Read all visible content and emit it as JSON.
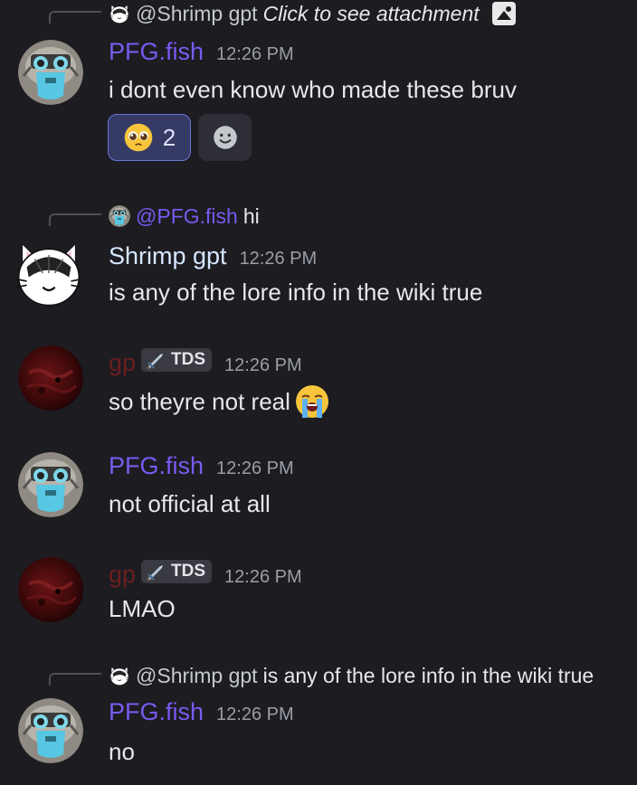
{
  "messages": [
    {
      "reply": {
        "username": "@Shrimp gpt",
        "text": "Click to see attachment",
        "italic": true,
        "avatar_icon": "cat-avatar-icon",
        "attachment_icon": "image-icon"
      },
      "username": "PFG.fish",
      "timestamp": "12:26 PM",
      "avatar_icon": "fish-mask-avatar",
      "text": "i dont even know who made these bruv",
      "reactions": [
        {
          "emoji": "pleading-face-emoji",
          "count": "2"
        }
      ],
      "add_reaction_icon": "smile-add-reaction-icon"
    },
    {
      "reply": {
        "username": "@PFG.fish",
        "text": "hi",
        "avatar_icon": "fish-mask-avatar-small"
      },
      "username": "Shrimp gpt",
      "timestamp": "12:26 PM",
      "avatar_icon": "cat-avatar",
      "text": "is any of the lore info in the wiki true"
    },
    {
      "username": "gp",
      "tag": "TDS",
      "tag_icon": "sword-icon",
      "timestamp": "12:26 PM",
      "avatar_icon": "red-planet-avatar",
      "text": "so theyre not real",
      "trailing_emoji": "loudly-crying-face-emoji"
    },
    {
      "username": "PFG.fish",
      "timestamp": "12:26 PM",
      "avatar_icon": "fish-mask-avatar",
      "text": "not official at all"
    },
    {
      "username": "gp",
      "tag": "TDS",
      "tag_icon": "sword-icon",
      "timestamp": "12:26 PM",
      "avatar_icon": "red-planet-avatar",
      "text": "LMAO"
    },
    {
      "reply": {
        "username": "@Shrimp gpt",
        "text": "is any of the lore info in the wiki true",
        "avatar_icon": "cat-avatar-icon"
      },
      "username": "PFG.fish",
      "timestamp": "12:26 PM",
      "avatar_icon": "fish-mask-avatar",
      "text": "no"
    }
  ],
  "colors": {
    "background": "#1c1c21",
    "pfg_name": "#7a5af0",
    "shrimp_name": "#d6e6ff",
    "gp_name": "#6a1f20",
    "reaction_active_bg": "#363b66",
    "reaction_active_border": "#6a74d8"
  }
}
